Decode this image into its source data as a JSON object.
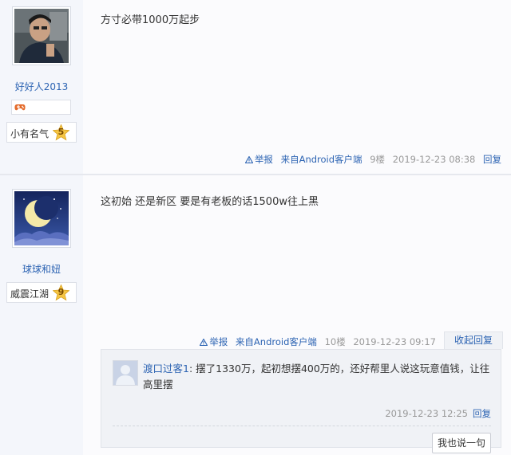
{
  "posts": [
    {
      "username": "好好人2013",
      "level_name": "小有名气",
      "level_num": "5",
      "content": "方寸必带1000万起步",
      "meta": {
        "report": "举报",
        "client": "来自Android客户端",
        "floor": "9楼",
        "time": "2019-12-23 08:38",
        "reply": "回复"
      }
    },
    {
      "username": "球球和妞",
      "level_name": "威震江湖",
      "level_num": "9",
      "content": "这初始 还是新区 要是有老板的话1500w往上黑",
      "meta": {
        "report": "举报",
        "client": "来自Android客户端",
        "floor": "10楼",
        "time": "2019-12-23 09:17",
        "collapse_reply": "收起回复"
      },
      "sub_reply": {
        "user": "渡口过客1",
        "colon": ": ",
        "text": "摆了1330万，起初想摆400万的，还好帮里人说这玩意值钱，让往高里摆",
        "time": "2019-12-23 12:25",
        "reply": "回复",
        "say_button": "我也说一句"
      }
    }
  ],
  "colors": {
    "link_blue": "#2d64b3",
    "sidebar_bg": "#f4f6fb",
    "meta_gray": "#999999"
  },
  "icons": {
    "warning": "warning-icon",
    "badge": "game-controller-icon",
    "level": "star-icon"
  }
}
